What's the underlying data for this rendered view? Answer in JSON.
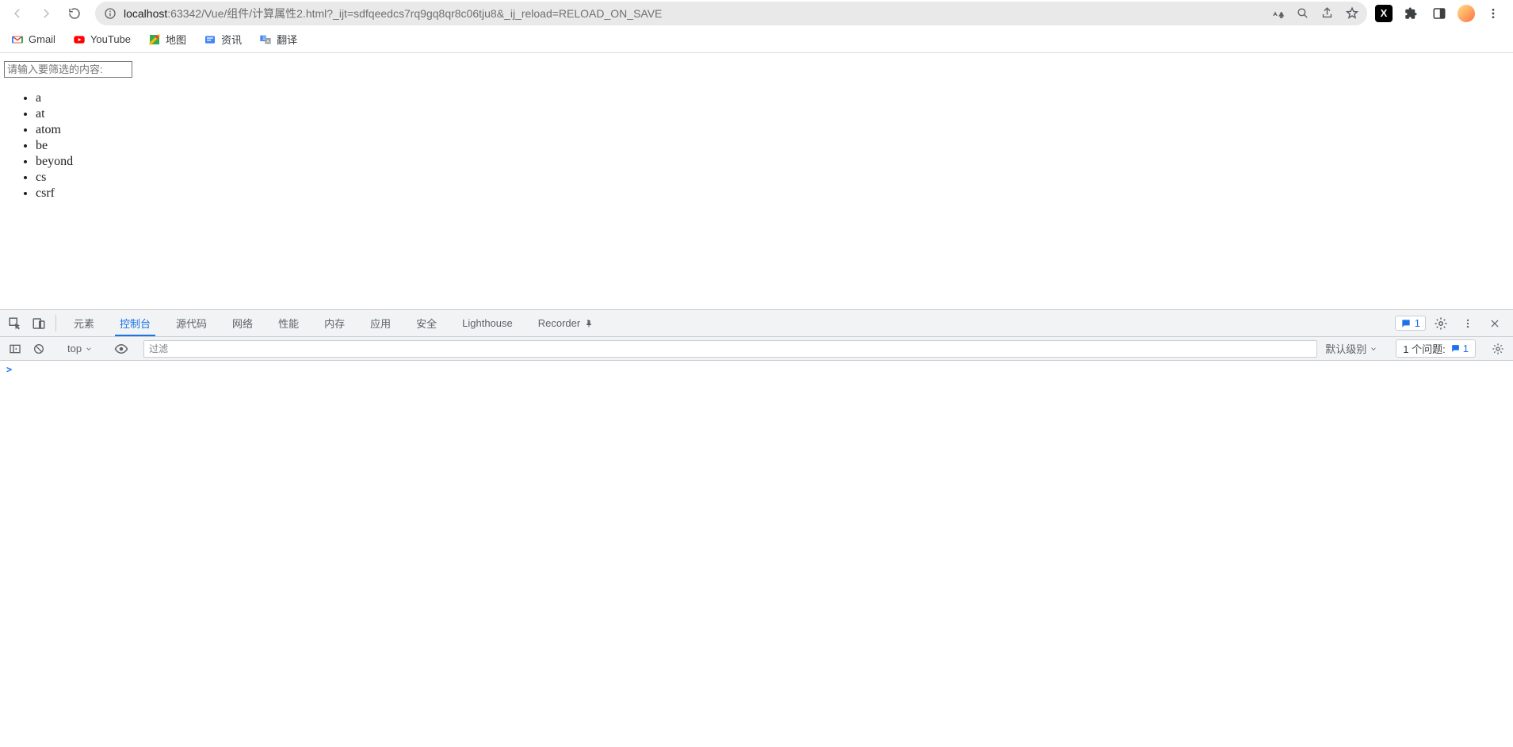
{
  "browser": {
    "url_host": "localhost",
    "url_path": ":63342/Vue/组件/计算属性2.html?_ijt=sdfqeedcs7rq9gq8qr8c06tju8&_ij_reload=RELOAD_ON_SAVE"
  },
  "bookmarks": [
    {
      "label": "Gmail"
    },
    {
      "label": "YouTube"
    },
    {
      "label": "地图"
    },
    {
      "label": "资讯"
    },
    {
      "label": "翻译"
    }
  ],
  "page": {
    "input_placeholder": "请输入要筛选的内容:",
    "input_value": "",
    "items": [
      "a",
      "at",
      "atom",
      "be",
      "beyond",
      "cs",
      "csrf"
    ]
  },
  "devtools": {
    "tabs": [
      "元素",
      "控制台",
      "源代码",
      "网络",
      "性能",
      "内存",
      "应用",
      "安全",
      "Lighthouse",
      "Recorder"
    ],
    "active_tab_index": 1,
    "badge_count": "1",
    "context_label": "top",
    "filter_placeholder": "过滤",
    "level_label": "默认级别",
    "issues_label": "1 个问题:",
    "issues_count": "1",
    "prompt": ">"
  }
}
